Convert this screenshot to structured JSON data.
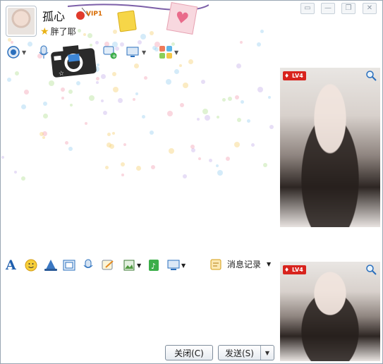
{
  "window": {
    "controls": [
      "▭",
      "—",
      "❐",
      "✕"
    ]
  },
  "header": {
    "nickname": "孤心",
    "vip_label": "VIP1",
    "signature": "胖了耶"
  },
  "top_toolbar": {
    "icons": [
      "video-call-icon",
      "voice-call-icon",
      "send-file-icon",
      "group-chat-icon",
      "remote-assist-icon",
      "apps-icon"
    ]
  },
  "video": {
    "top_level": "LV4",
    "bottom_level": "LV4"
  },
  "bottom_toolbar": {
    "font_icon": "A",
    "history_label": "消息记录"
  },
  "input": {
    "value": ""
  },
  "buttons": {
    "close_label": "关闭(C)",
    "send_label": "发送(S)",
    "send_dropdown": "▼"
  },
  "colors": {
    "accent_blue": "#2a6fbd",
    "badge_red": "#d8231d"
  }
}
